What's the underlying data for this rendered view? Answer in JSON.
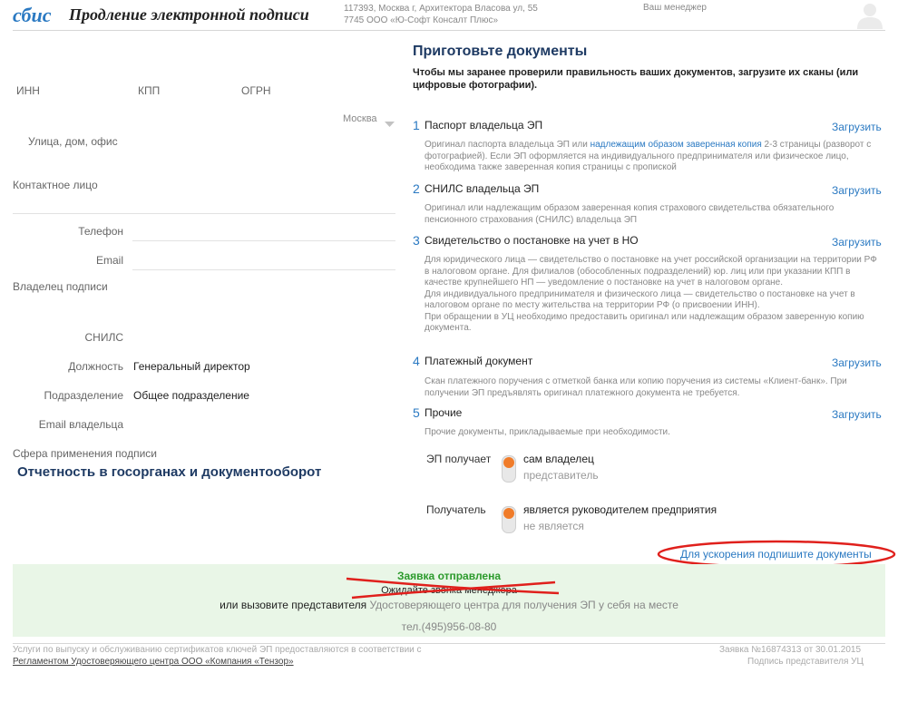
{
  "header": {
    "logo": "сбис",
    "title": "Продление электронной подписи",
    "address_line1": "117393, Москва г, Архитектора Власова ул, 55",
    "address_line2": "7745 ООО «Ю-Софт Консалт Плюс»",
    "manager": "Ваш менеджер"
  },
  "form": {
    "inn": "ИНН",
    "kpp": "КПП",
    "ogrn": "ОГРН",
    "city": "Москва",
    "street": "Улица, дом, офис",
    "contact": "Контактное лицо",
    "phone": "Телефон",
    "email": "Email",
    "owner": "Владелец подписи",
    "snils": "СНИЛС",
    "position_label": "Должность",
    "position_value": "Генеральный директор",
    "department_label": "Подразделение",
    "department_value": "Общее подразделение",
    "owner_email": "Email владельца",
    "sphere_label": "Сфера применения подписи",
    "sphere_value": "Отчетность в госорганах и документооборот"
  },
  "documents": {
    "title": "Приготовьте документы",
    "subtitle": "Чтобы мы заранее проверили правильность ваших документов, загрузите их сканы (или цифровые фотографии).",
    "upload_label": "Загрузить",
    "items": [
      {
        "num": "1",
        "name": "Паспорт владельца ЭП",
        "desc_pre": "Оригинал паспорта владельца ЭП или ",
        "desc_link": "надлежащим образом заверенная копия",
        "desc_post": " 2-3 страницы (разворот с фотографией). Если ЭП оформляется на индивидуального предпринимателя или физическое лицо, необходима также заверенная копия страницы с пропиской"
      },
      {
        "num": "2",
        "name": "СНИЛС владельца ЭП",
        "desc": "Оригинал или надлежащим образом заверенная копия страхового свидетельства обязательного пенсионного страхования (СНИЛС) владельца ЭП"
      },
      {
        "num": "3",
        "name": "Свидетельство о постановке на учет в НО",
        "desc_a": "Для юридического лица — свидетельство о постановке на учет российской организации на территории РФ в налоговом органе. Для филиалов (обособленных подразделений) юр. лиц или при указании КПП в качестве крупнейшего НП — уведомление о постановке на учет в налоговом органе.",
        "desc_b": "Для индивидуального предпринимателя и физического лица — свидетельство о постановке на учет в налоговом органе по месту жительства на территории РФ (о присвоении ИНН).",
        "desc_c": "При обращении в УЦ необходимо предоставить оригинал или надлежащим образом заверенную копию документа."
      },
      {
        "num": "4",
        "name": "Платежный документ",
        "desc": "Скан платежного поручения с отметкой банка или копию поручения из системы «Клиент-банк». При получении ЭП предъявлять оригинал платежного документа не требуется."
      },
      {
        "num": "5",
        "name": "Прочие",
        "desc": "Прочие документы, прикладываемые при необходимости."
      }
    ]
  },
  "receipt": {
    "ep_label": "ЭП получает",
    "ep_opt1": "сам владелец",
    "ep_opt2": "представитель",
    "rec_label": "Получатель",
    "rec_opt1": "является руководителем предприятия",
    "rec_opt2": "не является"
  },
  "sign_link": "Для ускорения подпишите документы",
  "status": {
    "sent": "Заявка отправлена",
    "wait": "Ожидайте звонка менеджера",
    "call_a": "или вызовите представителя",
    "call_b": " Удостоверяющего центра для получения ЭП у себя на месте",
    "phone": "тел.(495)956-08-80"
  },
  "footer": {
    "line1": "Услуги по выпуску и обслуживанию сертификатов ключей ЭП предоставляются в соответствии с",
    "line2": "Регламентом Удостоверяющего центра ООО «Компания «Тензор»",
    "request": "Заявка №16874313 от 30.01.2015",
    "sign": "Подпись представителя УЦ"
  },
  "colors": {
    "accent": "#2a79c2",
    "heading": "#1e3a63",
    "success": "#2c9a2c",
    "success_bg": "#e9f6e7",
    "annotation_red": "#e0201c",
    "toggle_knob": "#f07c2a"
  }
}
